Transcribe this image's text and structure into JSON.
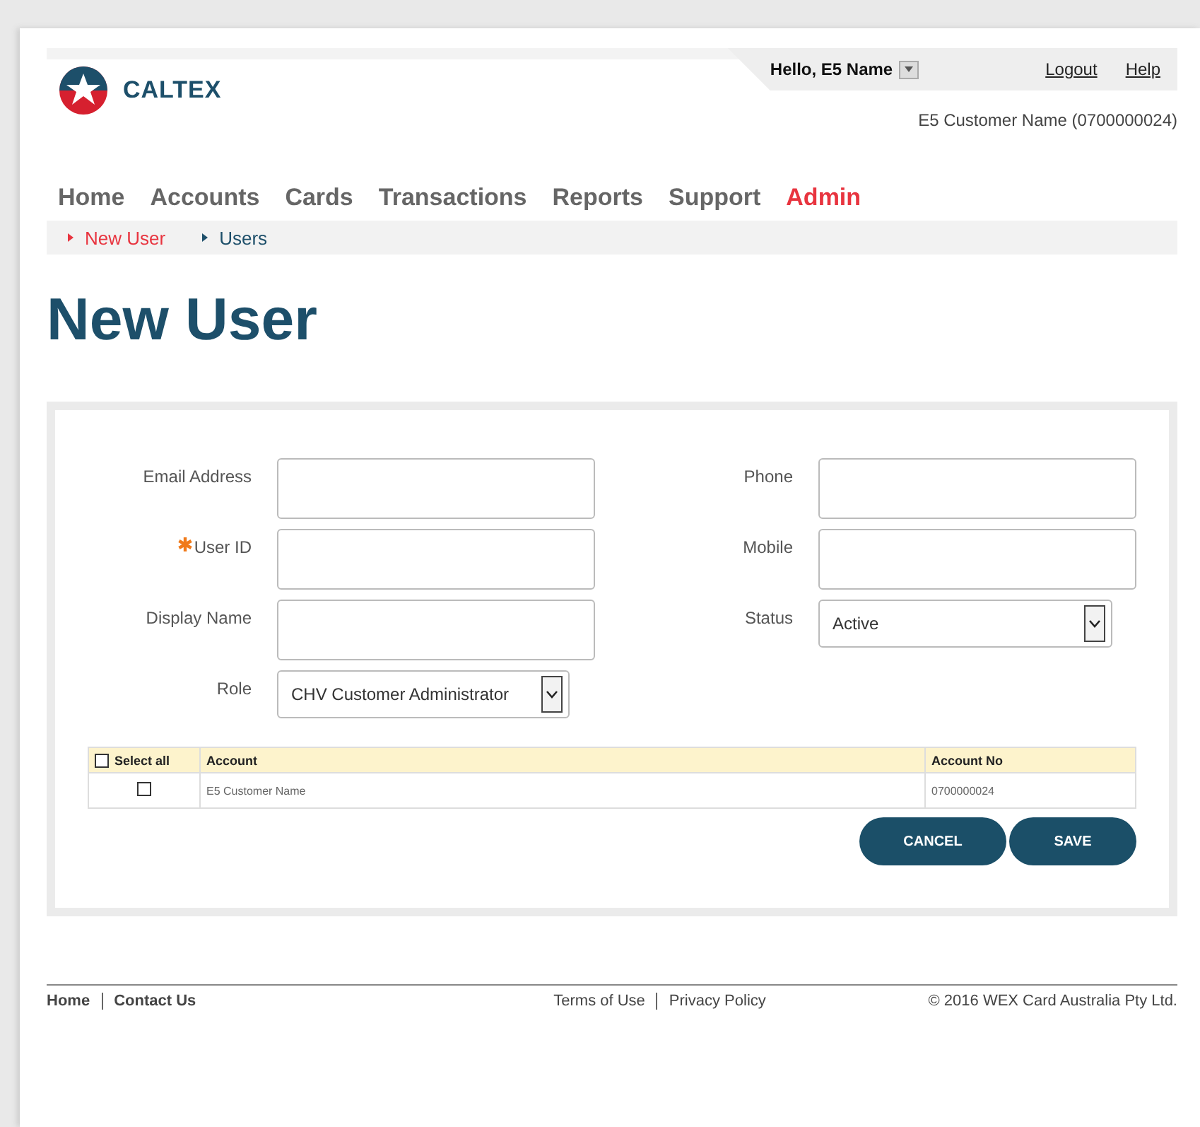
{
  "header": {
    "logo_text": "CALTEX",
    "greeting": "Hello, E5 Name",
    "links": [
      "Logout",
      "Help"
    ],
    "customer": "E5 Customer Name (0700000024)"
  },
  "nav": [
    {
      "label": "Home",
      "selected": false
    },
    {
      "label": "Accounts",
      "selected": false
    },
    {
      "label": "Cards",
      "selected": false
    },
    {
      "label": "Transactions",
      "selected": false
    },
    {
      "label": "Reports",
      "selected": false
    },
    {
      "label": "Support",
      "selected": false
    },
    {
      "label": "Admin",
      "selected": true
    }
  ],
  "subnav": [
    {
      "label": "New User",
      "selected": true
    },
    {
      "label": "Users",
      "selected": false
    }
  ],
  "title": "New User",
  "form": {
    "left": [
      {
        "label": "Email Address",
        "kind": "text",
        "required": false
      },
      {
        "label": "User ID",
        "kind": "text",
        "required": true
      },
      {
        "label": "Display Name",
        "kind": "text",
        "required": false
      },
      {
        "label": "Role",
        "kind": "select",
        "required": false,
        "value": "CHV Customer Administrator"
      }
    ],
    "right": [
      {
        "label": "Phone",
        "kind": "text",
        "required": false
      },
      {
        "label": "Mobile",
        "kind": "text",
        "required": false
      },
      {
        "label": "Status",
        "kind": "select",
        "required": false,
        "value": "Active"
      }
    ]
  },
  "table": {
    "select_all": {
      "label": "Select all",
      "checked": false
    },
    "columns": [
      "Account",
      "Account No"
    ],
    "rows": [
      {
        "checked": false,
        "cells": [
          "E5 Customer Name",
          "0700000024"
        ]
      }
    ]
  },
  "buttons": [
    "CANCEL",
    "SAVE"
  ],
  "footer": {
    "left": [
      "Home",
      "Contact Us"
    ],
    "middle": [
      "Terms of Use",
      "Privacy Policy"
    ],
    "copyright": "© 2016 WEX Card Australia Pty Ltd."
  }
}
